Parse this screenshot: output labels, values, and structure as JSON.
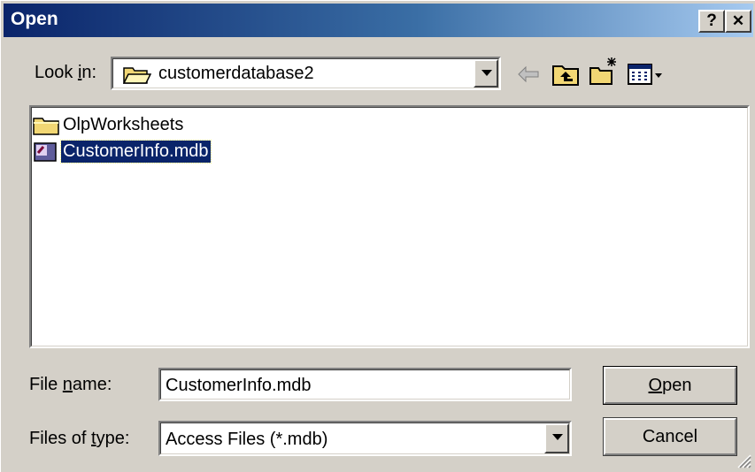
{
  "window": {
    "title": "Open",
    "help_label": "?",
    "close_label": "✕"
  },
  "toolbar": {
    "look_in_label": "Look in:",
    "look_in_value": "customerdatabase2",
    "icons": [
      "folder-open-icon",
      "back-arrow-icon",
      "up-one-level-icon",
      "create-new-folder-icon",
      "view-menu-icon"
    ]
  },
  "files": [
    {
      "name": "OlpWorksheets",
      "icon": "folder-icon",
      "selected": false
    },
    {
      "name": "CustomerInfo.mdb",
      "icon": "access-database-icon",
      "selected": true
    }
  ],
  "form": {
    "file_name_label": "File name:",
    "file_name_value": "CustomerInfo.mdb",
    "file_type_label": "Files of type:",
    "file_type_value": "Access Files (*.mdb)"
  },
  "buttons": {
    "open": "Open",
    "cancel": "Cancel"
  },
  "colors": {
    "title_start": "#0a246a",
    "title_end": "#a6caf0",
    "selection": "#0a246a",
    "face": "#d4d0c8"
  }
}
